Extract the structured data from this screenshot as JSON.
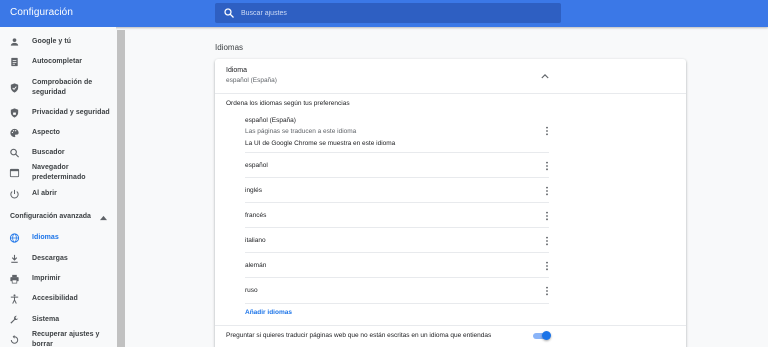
{
  "header": {
    "title": "Configuración",
    "search_placeholder": "Buscar ajustes",
    "background_color": "#3b78e7"
  },
  "sidebar": {
    "items": [
      {
        "label": "Google y tú",
        "icon": "person-icon"
      },
      {
        "label": "Autocompletar",
        "icon": "assignment-icon"
      },
      {
        "label": "Comprobación de seguridad",
        "icon": "shield-icon"
      },
      {
        "label": "Privacidad y seguridad",
        "icon": "lock-shield-icon"
      },
      {
        "label": "Aspecto",
        "icon": "palette-icon"
      },
      {
        "label": "Buscador",
        "icon": "search-icon"
      },
      {
        "label": "Navegador predeterminado",
        "icon": "browser-icon"
      },
      {
        "label": "Al abrir",
        "icon": "power-icon"
      }
    ],
    "advanced_label": "Configuración avanzada",
    "advanced_items": [
      {
        "label": "Idiomas",
        "icon": "globe-icon",
        "active": true
      },
      {
        "label": "Descargas",
        "icon": "download-icon"
      },
      {
        "label": "Imprimir",
        "icon": "print-icon"
      },
      {
        "label": "Accesibilidad",
        "icon": "accessibility-icon"
      },
      {
        "label": "Sistema",
        "icon": "wrench-icon"
      },
      {
        "label": "Recuperar ajustes y borrar",
        "icon": "restore-icon"
      }
    ],
    "active_color": "#1a73e8"
  },
  "main": {
    "section_title": "Idiomas",
    "card": {
      "title": "Idioma",
      "subtitle": "español (España)",
      "order_label": "Ordena los idiomas según tus preferencias",
      "languages": [
        {
          "name": "español (España)",
          "notes": [
            "Las páginas se traducen a este idioma",
            "La UI de Google Chrome se muestra en este idioma"
          ]
        },
        {
          "name": "español"
        },
        {
          "name": "inglés"
        },
        {
          "name": "francés"
        },
        {
          "name": "italiano"
        },
        {
          "name": "alemán"
        },
        {
          "name": "ruso"
        }
      ],
      "add_languages": "Añadir idiomas",
      "offer_translate": "Preguntar si quieres traducir páginas web que no están escritas en un idioma que entiendas",
      "offer_translate_enabled": true
    }
  }
}
